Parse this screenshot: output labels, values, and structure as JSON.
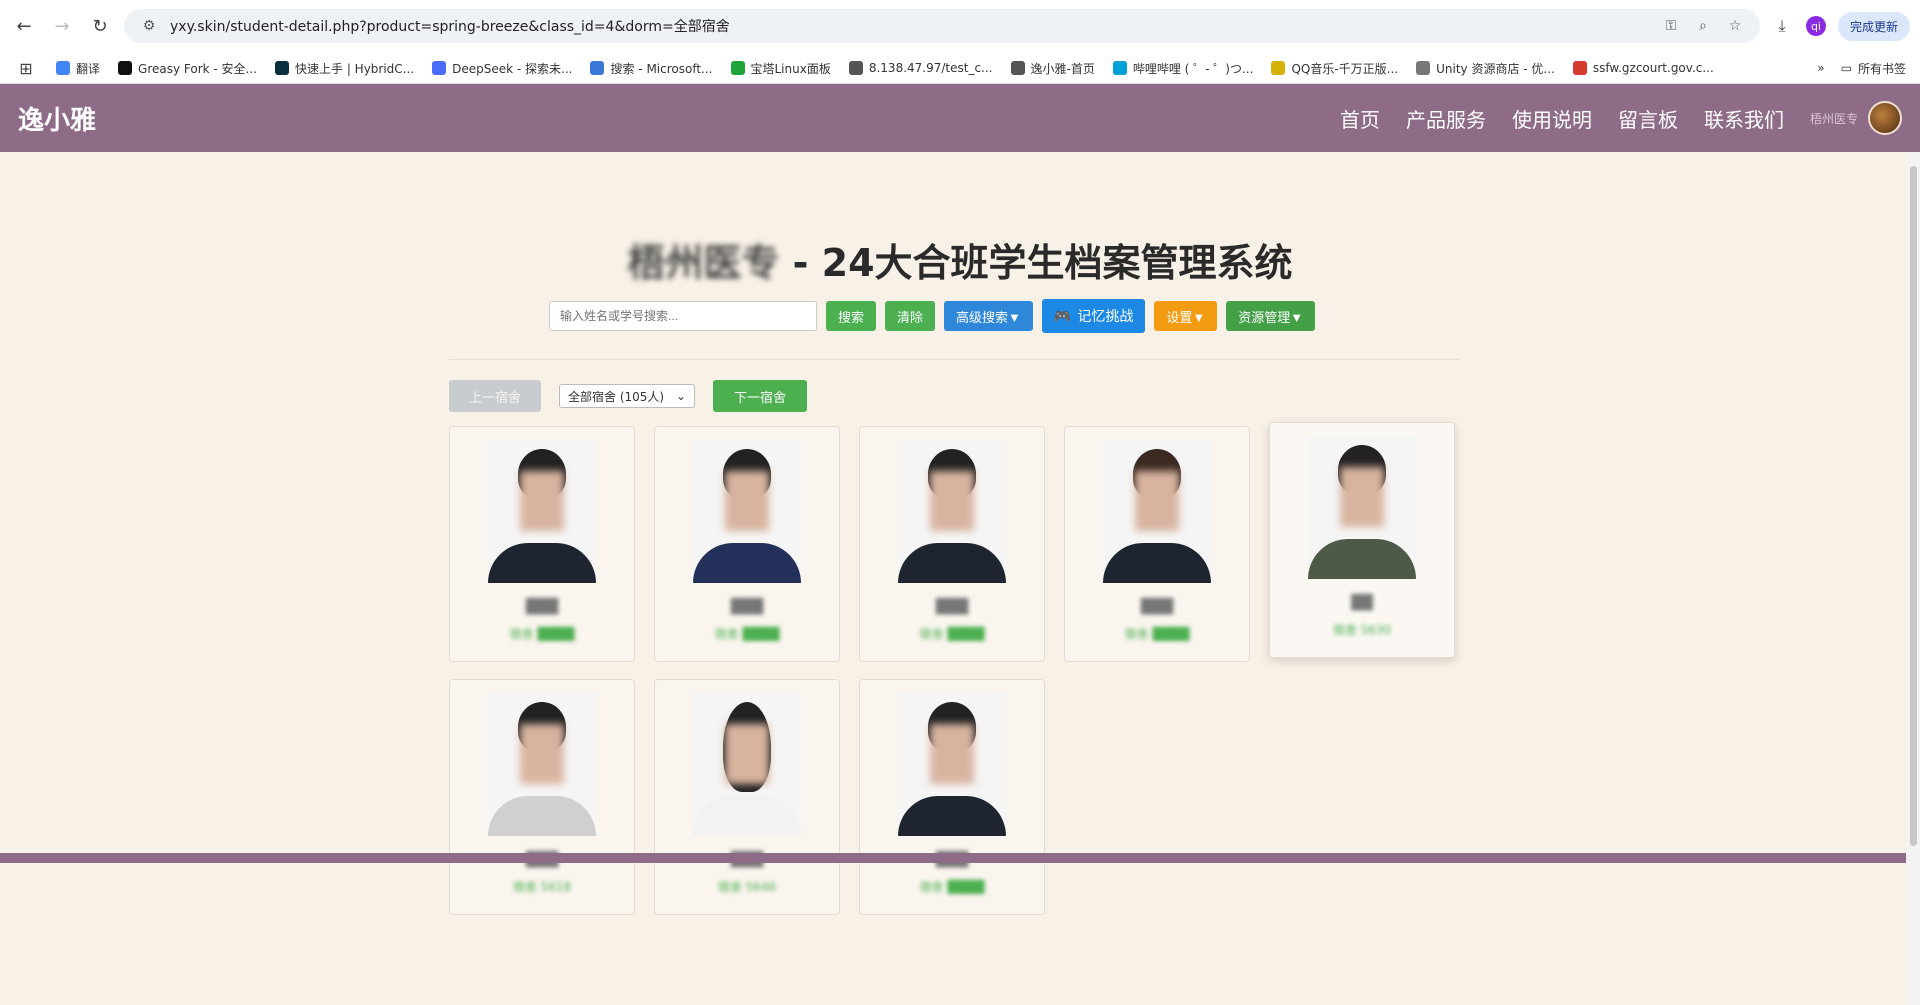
{
  "browser": {
    "url": "yxy.skin/student-detail.php?product=spring-breeze&class_id=4&dorm=全部宿舍",
    "profile_initial": "qi",
    "update_label": "完成更新",
    "bookmarks": [
      {
        "label": "翻译",
        "color": "#4285f4"
      },
      {
        "label": "Greasy Fork - 安全...",
        "color": "#111111"
      },
      {
        "label": "快速上手 | HybridC...",
        "color": "#0a3040"
      },
      {
        "label": "DeepSeek - 探索未...",
        "color": "#4b6bfb"
      },
      {
        "label": "搜索 - Microsoft...",
        "color": "#3a78d8"
      },
      {
        "label": "宝塔Linux面板",
        "color": "#20a53a"
      },
      {
        "label": "8.138.47.97/test_c...",
        "color": "#555555"
      },
      {
        "label": "逸小雅-首页",
        "color": "#555555"
      },
      {
        "label": "哔哩哔哩 ( ゜- ゜)つ...",
        "color": "#00a1d6"
      },
      {
        "label": "QQ音乐-千万正版...",
        "color": "#d4b106"
      },
      {
        "label": "Unity 资源商店 - 优...",
        "color": "#777777"
      },
      {
        "label": "ssfw.gzcourt.gov.c...",
        "color": "#d63b2f"
      }
    ],
    "all_bookmarks_label": "所有书签"
  },
  "site": {
    "logo": "逸小雅",
    "nav": [
      "首页",
      "产品服务",
      "使用说明",
      "留言板",
      "联系我们"
    ],
    "user_name": "梧州医专"
  },
  "main": {
    "title_blurred": "梧州医专",
    "title_rest": " - 24大合班学生档案管理系统",
    "search_placeholder": "输入姓名或学号搜索...",
    "buttons": {
      "search": "搜索",
      "clear": "清除",
      "advanced": "高级搜索▼",
      "memory": "记忆挑战",
      "settings": "设置▼",
      "resources": "资源管理▼"
    },
    "dorm": {
      "prev": "上一宿舍",
      "selected": "全部宿舍 (105人)",
      "next": "下一宿舍"
    },
    "students": [
      {
        "name": "███",
        "dorm": "宿舍 ████"
      },
      {
        "name": "███",
        "dorm": "宿舍 ████"
      },
      {
        "name": "███",
        "dorm": "宿舍 ████"
      },
      {
        "name": "███",
        "dorm": "宿舍 ████"
      },
      {
        "name": "██",
        "dorm": "宿舍 5630"
      },
      {
        "name": "███",
        "dorm": "宿舍 5618"
      },
      {
        "name": "███",
        "dorm": "宿舍 5646"
      },
      {
        "name": "███",
        "dorm": "宿舍 ████"
      }
    ]
  }
}
